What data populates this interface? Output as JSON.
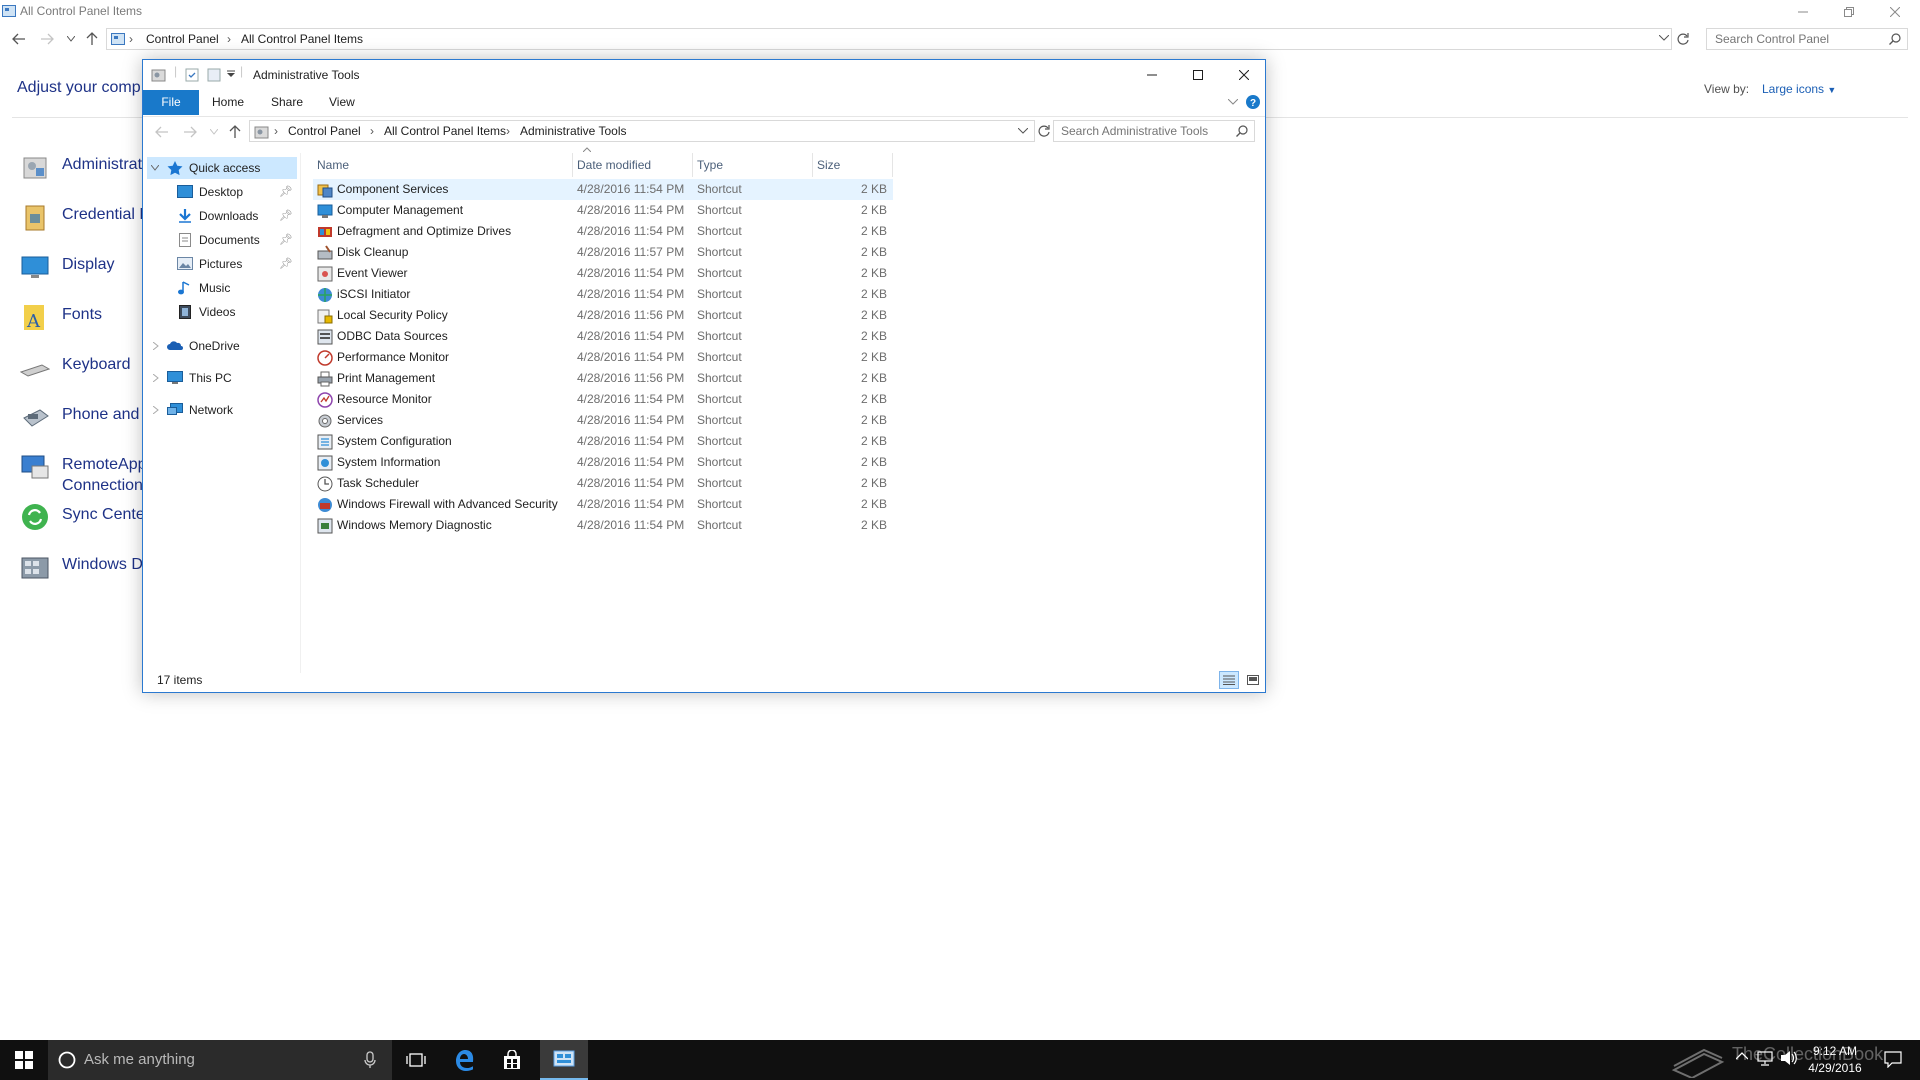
{
  "background_window": {
    "title": "All Control Panel Items",
    "breadcrumb": [
      "Control Panel",
      "All Control Panel Items"
    ],
    "search_placeholder": "Search Control Panel",
    "heading": "Adjust your comp",
    "view_by_label": "View by:",
    "view_by_value": "Large icons",
    "items": [
      {
        "label": "Administrati",
        "icon": "admin-tools-icon"
      },
      {
        "label": "Credential M",
        "icon": "credential-icon"
      },
      {
        "label": "Display",
        "icon": "display-icon"
      },
      {
        "label": "Fonts",
        "icon": "fonts-icon"
      },
      {
        "label": "Keyboard",
        "icon": "keyboard-icon"
      },
      {
        "label": "Phone and",
        "icon": "phone-icon"
      },
      {
        "label": "RemoteApp",
        "label2": "Connection",
        "icon": "remoteapp-icon"
      },
      {
        "label": "Sync Center",
        "icon": "sync-icon"
      },
      {
        "label": "Windows D",
        "icon": "windows-defender-icon"
      }
    ]
  },
  "explorer": {
    "title": "Administrative Tools",
    "ribbon_tabs": [
      "File",
      "Home",
      "Share",
      "View"
    ],
    "breadcrumb": [
      "Control Panel",
      "All Control Panel Items",
      "Administrative Tools"
    ],
    "search_placeholder": "Search Administrative Tools",
    "nav": {
      "quick_access": "Quick access",
      "pinned": [
        "Desktop",
        "Downloads",
        "Documents",
        "Pictures"
      ],
      "unpinned": [
        "Music",
        "Videos"
      ],
      "onedrive": "OneDrive",
      "this_pc": "This PC",
      "network": "Network"
    },
    "columns": [
      "Name",
      "Date modified",
      "Type",
      "Size"
    ],
    "files": [
      {
        "name": "Component Services",
        "date": "4/28/2016 11:54 PM",
        "type": "Shortcut",
        "size": "2 KB"
      },
      {
        "name": "Computer Management",
        "date": "4/28/2016 11:54 PM",
        "type": "Shortcut",
        "size": "2 KB"
      },
      {
        "name": "Defragment and Optimize Drives",
        "date": "4/28/2016 11:54 PM",
        "type": "Shortcut",
        "size": "2 KB"
      },
      {
        "name": "Disk Cleanup",
        "date": "4/28/2016 11:57 PM",
        "type": "Shortcut",
        "size": "2 KB"
      },
      {
        "name": "Event Viewer",
        "date": "4/28/2016 11:54 PM",
        "type": "Shortcut",
        "size": "2 KB"
      },
      {
        "name": "iSCSI Initiator",
        "date": "4/28/2016 11:54 PM",
        "type": "Shortcut",
        "size": "2 KB"
      },
      {
        "name": "Local Security Policy",
        "date": "4/28/2016 11:56 PM",
        "type": "Shortcut",
        "size": "2 KB"
      },
      {
        "name": "ODBC Data Sources",
        "date": "4/28/2016 11:54 PM",
        "type": "Shortcut",
        "size": "2 KB"
      },
      {
        "name": "Performance Monitor",
        "date": "4/28/2016 11:54 PM",
        "type": "Shortcut",
        "size": "2 KB"
      },
      {
        "name": "Print Management",
        "date": "4/28/2016 11:56 PM",
        "type": "Shortcut",
        "size": "2 KB"
      },
      {
        "name": "Resource Monitor",
        "date": "4/28/2016 11:54 PM",
        "type": "Shortcut",
        "size": "2 KB"
      },
      {
        "name": "Services",
        "date": "4/28/2016 11:54 PM",
        "type": "Shortcut",
        "size": "2 KB"
      },
      {
        "name": "System Configuration",
        "date": "4/28/2016 11:54 PM",
        "type": "Shortcut",
        "size": "2 KB"
      },
      {
        "name": "System Information",
        "date": "4/28/2016 11:54 PM",
        "type": "Shortcut",
        "size": "2 KB"
      },
      {
        "name": "Task Scheduler",
        "date": "4/28/2016 11:54 PM",
        "type": "Shortcut",
        "size": "2 KB"
      },
      {
        "name": "Windows Firewall with Advanced Security",
        "date": "4/28/2016 11:54 PM",
        "type": "Shortcut",
        "size": "2 KB"
      },
      {
        "name": "Windows Memory Diagnostic",
        "date": "4/28/2016 11:54 PM",
        "type": "Shortcut",
        "size": "2 KB"
      }
    ],
    "status": "17 items"
  },
  "taskbar": {
    "search_placeholder": "Ask me anything",
    "time": "9:12 AM",
    "date": "4/29/2016",
    "watermark": "TheCollectionBook"
  },
  "colors": {
    "accent": "#1979ca",
    "link": "#1e3287",
    "selection": "#cce8ff",
    "taskbar": "#101010"
  }
}
